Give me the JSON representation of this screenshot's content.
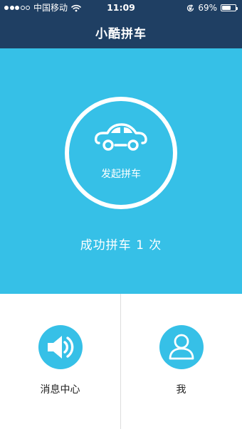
{
  "status_bar": {
    "carrier": "中国移动",
    "time": "11:09",
    "battery": "69%",
    "battery_level": 0.69,
    "signal_bars_filled": 3,
    "signal_bars_total": 5,
    "icons": [
      "signal-dots-icon",
      "wifi-icon",
      "rotation-lock-icon",
      "battery-icon"
    ]
  },
  "header": {
    "title": "小酷拼车"
  },
  "hero": {
    "start_button_label": "发起拼车",
    "start_button_icon": "car-icon",
    "success_text": "成功拼车 1 次"
  },
  "nav": {
    "items": [
      {
        "label": "消息中心",
        "icon": "speaker-icon"
      },
      {
        "label": "我",
        "icon": "person-icon"
      }
    ]
  },
  "colors": {
    "header_bg": "#1f3f63",
    "accent": "#36c0e7",
    "text_light": "#ffffff",
    "text_dark": "#222222",
    "divider": "#dddddd"
  }
}
